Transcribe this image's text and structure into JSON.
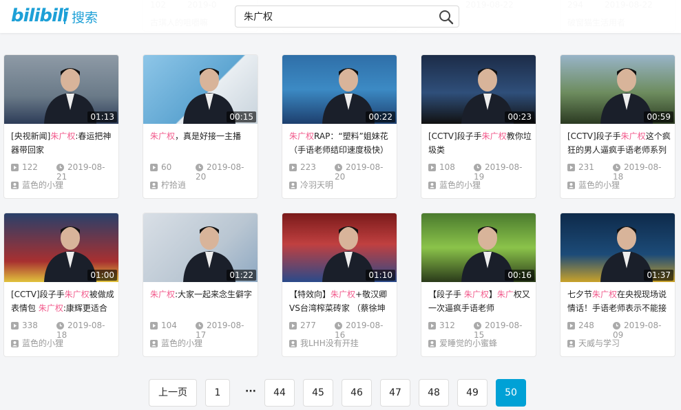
{
  "header": {
    "logo": "bilibili",
    "section": "搜索",
    "search_value": "朱广权"
  },
  "peek_cards": [
    {
      "plays": "102",
      "date": "2019-0",
      "uploader": "古琪人的咀嚼嘛"
    },
    {
      "plays": "",
      "date": "",
      "uploader": ""
    },
    {
      "plays": "",
      "date": "2019-08-22",
      "uploader": "小猫"
    },
    {
      "plays": "294",
      "date": "2019-08-22",
      "uploader": "破窗猫生活用者"
    }
  ],
  "cards": [
    {
      "duration": "01:13",
      "title": [
        {
          "t": "[央视新闻]"
        },
        {
          "t": "朱广权",
          "k": true
        },
        {
          "t": ":春运把神器带回家"
        }
      ],
      "plays": "122",
      "date": "2019-08-21",
      "uploader": "蓝色的小狸"
    },
    {
      "duration": "00:15",
      "title": [
        {
          "t": "朱广权",
          "k": true
        },
        {
          "t": "，真是好接一主播"
        }
      ],
      "plays": "60",
      "date": "2019-08-20",
      "uploader": "柠拾逍"
    },
    {
      "duration": "00:22",
      "title": [
        {
          "t": "朱广权",
          "k": true
        },
        {
          "t": "RAP：“塑料”姐妹花（手语老师结印速度极快）"
        }
      ],
      "plays": "223",
      "date": "2019-08-20",
      "uploader": "冷羽天明"
    },
    {
      "duration": "00:23",
      "title": [
        {
          "t": "[CCTV]段子手"
        },
        {
          "t": "朱广权",
          "k": true
        },
        {
          "t": "教你垃圾类"
        }
      ],
      "plays": "108",
      "date": "2019-08-19",
      "uploader": "蓝色的小狸"
    },
    {
      "duration": "00:59",
      "title": [
        {
          "t": "[CCTV]段子手"
        },
        {
          "t": "朱广权",
          "k": true
        },
        {
          "t": "这个疯狂的男人逼疯手语老师系列"
        }
      ],
      "plays": "231",
      "date": "2019-08-18",
      "uploader": "蓝色的小狸"
    },
    {
      "duration": "01:00",
      "title": [
        {
          "t": "[CCTV]段子手"
        },
        {
          "t": "朱广权",
          "k": true
        },
        {
          "t": "被做成表情包 "
        },
        {
          "t": "朱广权",
          "k": true
        },
        {
          "t": ":康辉更适合"
        }
      ],
      "plays": "338",
      "date": "2019-08-18",
      "uploader": "蓝色的小狸"
    },
    {
      "duration": "01:22",
      "title": [
        {
          "t": "朱广权",
          "k": true
        },
        {
          "t": ":大家一起来念生僻字"
        }
      ],
      "plays": "104",
      "date": "2019-08-17",
      "uploader": "蓝色的小狸"
    },
    {
      "duration": "01:10",
      "title": [
        {
          "t": "【特效向】"
        },
        {
          "t": "朱广权",
          "k": true
        },
        {
          "t": "+敬汉卿VS台湾榨菜砖家 （蔡徐坤"
        }
      ],
      "plays": "277",
      "date": "2019-08-16",
      "uploader": "我LHH没有开挂"
    },
    {
      "duration": "00:16",
      "title": [
        {
          "t": "【段子手 "
        },
        {
          "t": "朱广权",
          "k": true
        },
        {
          "t": "】"
        },
        {
          "t": "朱广",
          "k": true
        },
        {
          "t": "权又一次逼疯手语老师"
        }
      ],
      "plays": "312",
      "date": "2019-08-15",
      "uploader": "爱睡觉的小蜜蜂"
    },
    {
      "duration": "01:37",
      "title": [
        {
          "t": "七夕节"
        },
        {
          "t": "朱广权",
          "k": true
        },
        {
          "t": "在央视现场说情话！手语老师表示不能接"
        }
      ],
      "plays": "248",
      "date": "2019-08-09",
      "uploader": "天威与学习"
    }
  ],
  "pagination": {
    "prev": "上一页",
    "first": "1",
    "ellipsis": "···",
    "pages": [
      "44",
      "45",
      "46",
      "47",
      "48",
      "49",
      "50"
    ],
    "current": "50"
  }
}
